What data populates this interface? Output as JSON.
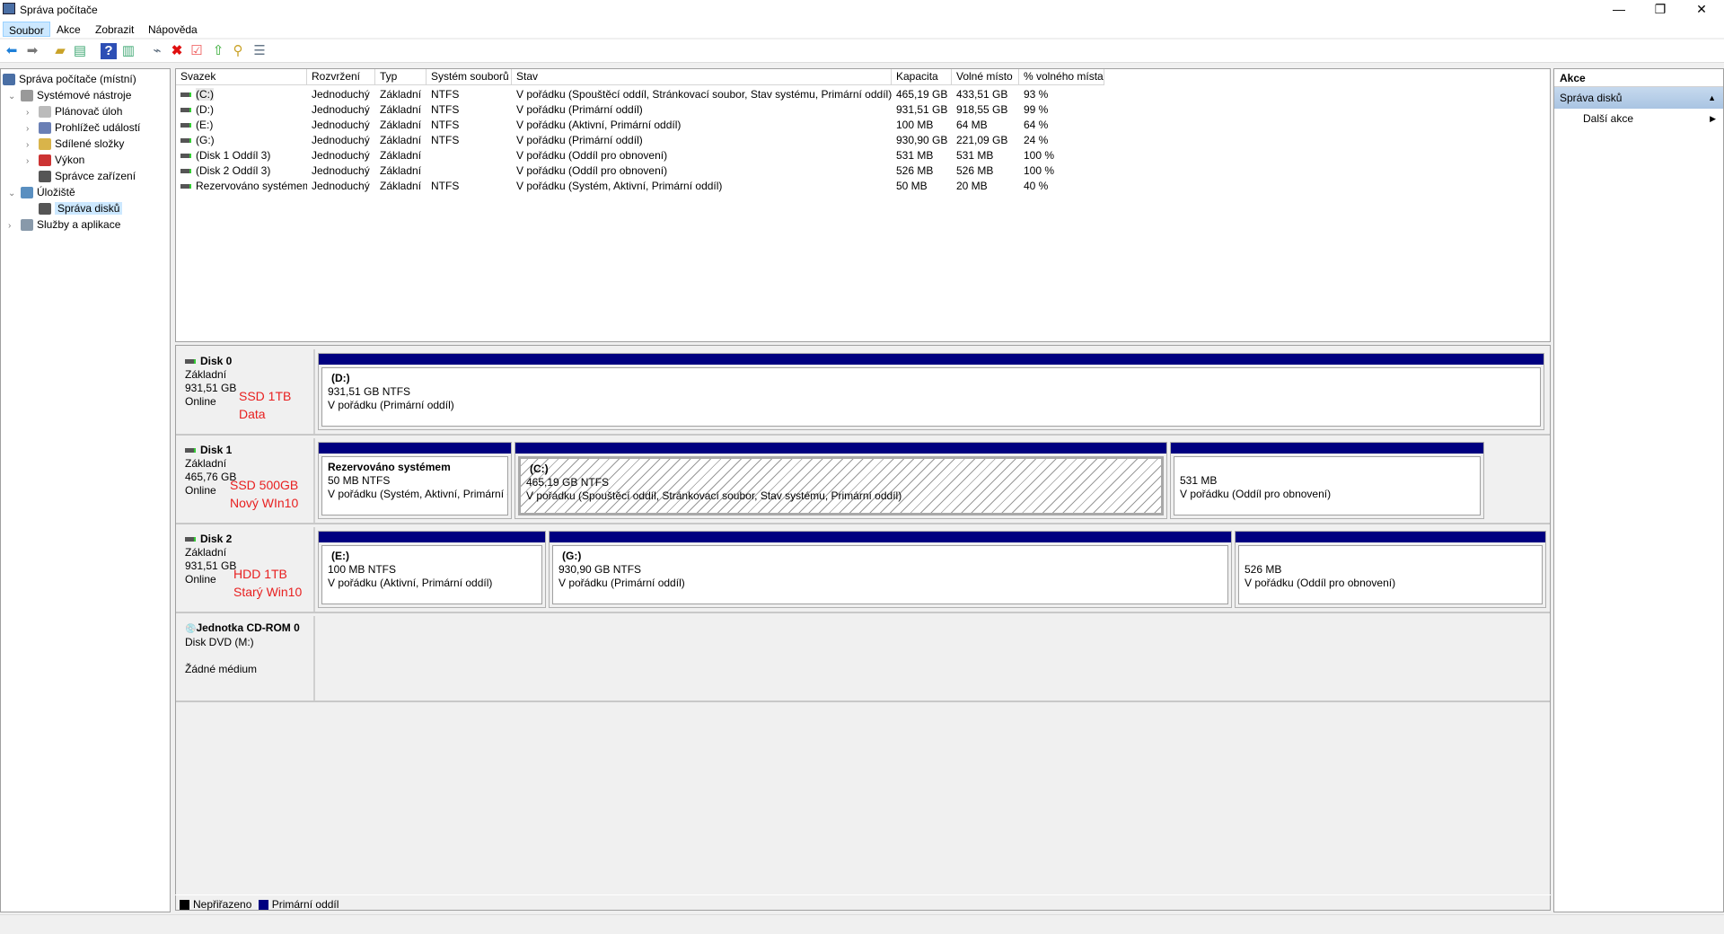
{
  "window": {
    "title": "Správa počítače",
    "minimize": "—",
    "restore": "❐",
    "close": "✕"
  },
  "menu": [
    "Soubor",
    "Akce",
    "Zobrazit",
    "Nápověda"
  ],
  "tree": [
    {
      "label": "Správa počítače (místní)",
      "icon": "computer-management-icon",
      "level": 0,
      "expander": ""
    },
    {
      "label": "Systémové nástroje",
      "icon": "tools-icon",
      "level": 1,
      "expander": "⌄"
    },
    {
      "label": "Plánovač úloh",
      "icon": "clock-icon",
      "level": 2,
      "expander": "›"
    },
    {
      "label": "Prohlížeč událostí",
      "icon": "event-viewer-icon",
      "level": 2,
      "expander": "›"
    },
    {
      "label": "Sdílené složky",
      "icon": "shared-folder-icon",
      "level": 2,
      "expander": "›"
    },
    {
      "label": "Výkon",
      "icon": "performance-icon",
      "level": 2,
      "expander": "›"
    },
    {
      "label": "Správce zařízení",
      "icon": "device-manager-icon",
      "level": 2,
      "expander": ""
    },
    {
      "label": "Úložiště",
      "icon": "storage-icon",
      "level": 1,
      "expander": "⌄"
    },
    {
      "label": "Správa disků",
      "icon": "disk-management-icon",
      "level": 2,
      "expander": "",
      "selected": true
    },
    {
      "label": "Služby a aplikace",
      "icon": "services-icon",
      "level": 1,
      "expander": "›"
    }
  ],
  "volumes": {
    "columns": [
      "Svazek",
      "Rozvržení",
      "Typ",
      "Systém souborů",
      "Stav",
      "Kapacita",
      "Volné místo",
      "% volného místa"
    ],
    "rows": [
      [
        "(C:)",
        "Jednoduchý",
        "Základní",
        "NTFS",
        "V pořádku (Spouštěcí oddíl, Stránkovací soubor, Stav systému, Primární oddíl)",
        "465,19 GB",
        "433,51 GB",
        "93 %"
      ],
      [
        "(D:)",
        "Jednoduchý",
        "Základní",
        "NTFS",
        "V pořádku (Primární oddíl)",
        "931,51 GB",
        "918,55 GB",
        "99 %"
      ],
      [
        "(E:)",
        "Jednoduchý",
        "Základní",
        "NTFS",
        "V pořádku (Aktivní, Primární oddíl)",
        "100 MB",
        "64 MB",
        "64 %"
      ],
      [
        "(G:)",
        "Jednoduchý",
        "Základní",
        "NTFS",
        "V pořádku (Primární oddíl)",
        "930,90 GB",
        "221,09 GB",
        "24 %"
      ],
      [
        "(Disk 1 Oddíl 3)",
        "Jednoduchý",
        "Základní",
        "",
        "V pořádku (Oddíl pro obnovení)",
        "531 MB",
        "531 MB",
        "100 %"
      ],
      [
        "(Disk 2 Oddíl 3)",
        "Jednoduchý",
        "Základní",
        "",
        "V pořádku (Oddíl pro obnovení)",
        "526 MB",
        "526 MB",
        "100 %"
      ],
      [
        "Rezervováno systémem",
        "Jednoduchý",
        "Základní",
        "NTFS",
        "V pořádku (Systém, Aktivní, Primární oddíl)",
        "50 MB",
        "20 MB",
        "40 %"
      ]
    ]
  },
  "disks": [
    {
      "name": "Disk 0",
      "type": "Základní",
      "size": "931,51 GB",
      "state": "Online",
      "note1": "SSD 1TB",
      "note2": "Data",
      "partitions": [
        {
          "name": "(D:)",
          "size": "931,51 GB NTFS",
          "status": "V pořádku (Primární oddíl)"
        }
      ]
    },
    {
      "name": "Disk 1",
      "type": "Základní",
      "size": "465,76 GB",
      "state": "Online",
      "note1": "SSD 500GB",
      "note2": "Nový WIn10",
      "partitions": [
        {
          "name": "Rezervováno systémem",
          "size": "50 MB NTFS",
          "status": "V pořádku (Systém, Aktivní, Primární o"
        },
        {
          "name": "(C:)",
          "size": "465,19 GB NTFS",
          "status": "V pořádku (Spouštěcí oddíl, Stránkovací soubor, Stav systému, Primární oddíl)"
        },
        {
          "name": "",
          "size": "531 MB",
          "status": "V pořádku (Oddíl pro obnovení)"
        }
      ]
    },
    {
      "name": "Disk 2",
      "type": "Základní",
      "size": "931,51 GB",
      "state": "Online",
      "note1": "HDD 1TB",
      "note2": "Starý Win10",
      "partitions": [
        {
          "name": "(E:)",
          "size": "100 MB NTFS",
          "status": "V pořádku (Aktivní, Primární oddíl)"
        },
        {
          "name": "(G:)",
          "size": "930,90 GB NTFS",
          "status": "V pořádku (Primární oddíl)"
        },
        {
          "name": "",
          "size": "526 MB",
          "status": "V pořádku (Oddíl pro obnovení)"
        }
      ]
    },
    {
      "name": "Jednotka CD-ROM 0",
      "type": "Disk DVD (M:)",
      "media": "Žádné médium"
    }
  ],
  "legend": [
    {
      "label": "Nepřiřazeno",
      "color": "#000000"
    },
    {
      "label": "Primární oddíl",
      "color": "#000080"
    }
  ],
  "actions": {
    "title": "Akce",
    "section": "Správa disků",
    "item": "Další akce"
  }
}
